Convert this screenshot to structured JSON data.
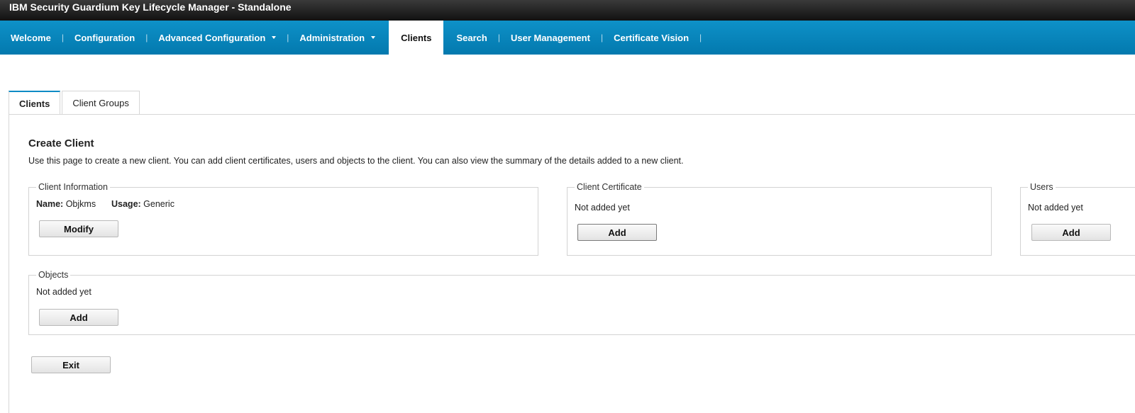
{
  "app": {
    "title": "IBM Security Guardium Key Lifecycle Manager - Standalone"
  },
  "nav": {
    "separator": "|",
    "items": [
      {
        "label": "Welcome"
      },
      {
        "label": "Configuration"
      },
      {
        "label": "Advanced Configuration"
      },
      {
        "label": "Administration"
      },
      {
        "label": "Clients"
      },
      {
        "label": "Search"
      },
      {
        "label": "User Management"
      },
      {
        "label": "Certificate Vision"
      }
    ]
  },
  "tabs": [
    {
      "label": "Clients"
    },
    {
      "label": "Client Groups"
    }
  ],
  "page": {
    "title": "Create Client",
    "description": "Use this page to create a new client. You can add client certificates, users and objects to the client. You can also view the summary of the details added to a new client."
  },
  "client_info": {
    "legend": "Client Information",
    "name_label": "Name:",
    "name_value": "Objkms",
    "usage_label": "Usage:",
    "usage_value": "Generic",
    "modify_label": "Modify"
  },
  "client_certificate": {
    "legend": "Client Certificate",
    "status": "Not added yet",
    "add_label": "Add"
  },
  "users": {
    "legend": "Users",
    "status": "Not added yet",
    "add_label": "Add"
  },
  "objects": {
    "legend": "Objects",
    "status": "Not added yet",
    "add_label": "Add"
  },
  "exit_label": "Exit",
  "colors": {
    "nav_blue": "#0a86bd",
    "titlebar": "#1e1e1e",
    "active_tab_accent": "#0e8bc5"
  }
}
